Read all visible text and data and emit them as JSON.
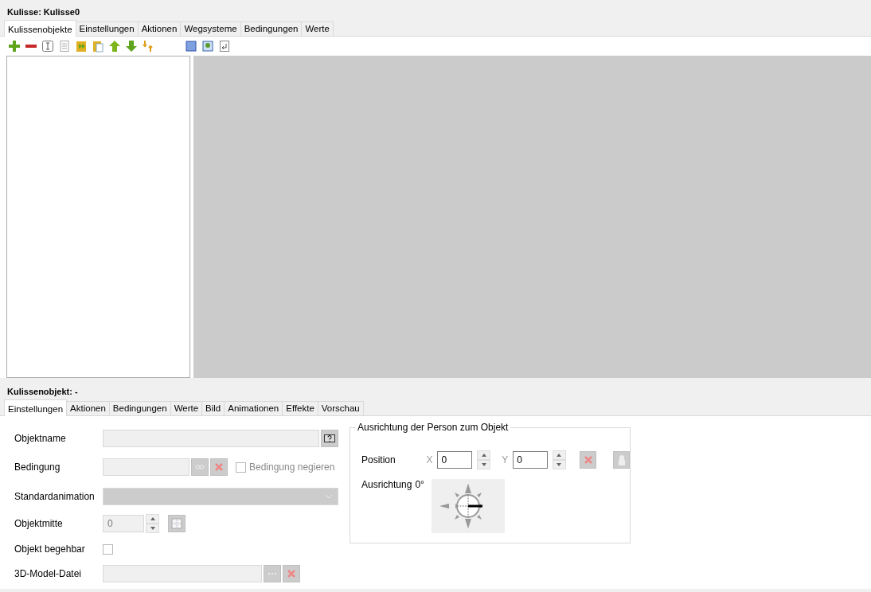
{
  "window": {
    "title": "Kulisse: Kulisse0"
  },
  "tabs": [
    {
      "label": "Kulissenobjekte",
      "selected": true
    },
    {
      "label": "Einstellungen",
      "selected": false
    },
    {
      "label": "Aktionen",
      "selected": false
    },
    {
      "label": "Wegsysteme",
      "selected": false
    },
    {
      "label": "Bedingungen",
      "selected": false
    },
    {
      "label": "Werte",
      "selected": false
    }
  ],
  "object_panel": {
    "title": "Kulissenobjekt: -",
    "tabs": [
      {
        "label": "Einstellungen",
        "selected": true
      },
      {
        "label": "Aktionen",
        "selected": false
      },
      {
        "label": "Bedingungen",
        "selected": false
      },
      {
        "label": "Werte",
        "selected": false
      },
      {
        "label": "Bild",
        "selected": false
      },
      {
        "label": "Animationen",
        "selected": false
      },
      {
        "label": "Effekte",
        "selected": false
      },
      {
        "label": "Vorschau",
        "selected": false
      }
    ],
    "form": [
      {
        "kind": "help-text",
        "label": "Objektname"
      },
      {
        "kind": "condition",
        "label": "Bedingung",
        "negate_label": "Bedingung negieren",
        "negate_checked": false
      },
      {
        "kind": "dropdown",
        "label": "Standardanimation"
      },
      {
        "kind": "spinner",
        "label": "Objektmitte",
        "value": "0"
      },
      {
        "kind": "checkbox",
        "label": "Objekt begehbar",
        "checked": false
      },
      {
        "kind": "file",
        "label": "3D-Model-Datei"
      }
    ],
    "orientation_group": {
      "title": "Ausrichtung der Person zum Objekt",
      "position_label": "Position",
      "x_label": "X",
      "x_value": "0",
      "y_label": "Y",
      "y_value": "0",
      "orientation_label": "Ausrichtung",
      "angle": "0°"
    }
  }
}
